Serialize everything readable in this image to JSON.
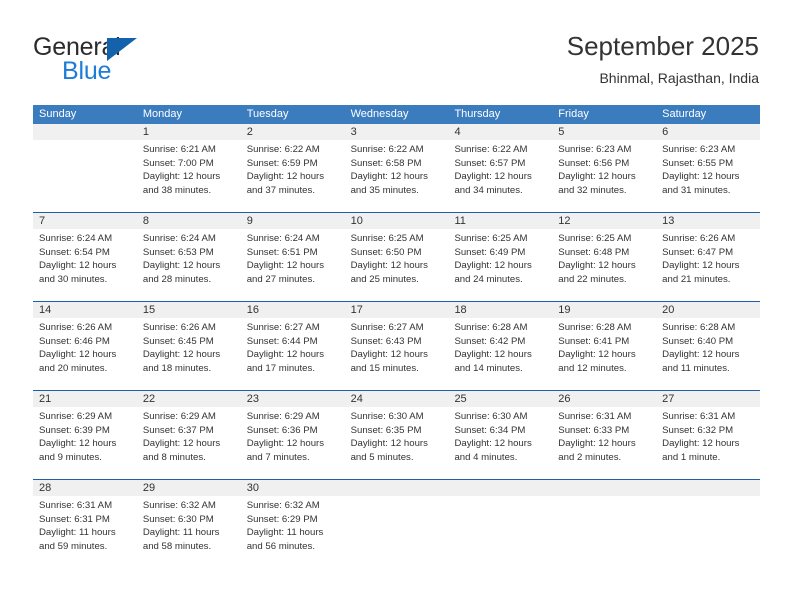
{
  "brand": {
    "name_part1": "General",
    "name_part2": "Blue",
    "triangle_color": "#1462ac",
    "blue_text_color": "#1c7cd6"
  },
  "header": {
    "title": "September 2025",
    "location": "Bhinmal, Rajasthan, India"
  },
  "theme": {
    "header_bar_color": "#3a7cbe",
    "week_separator_color": "#1f5fa8",
    "daynum_band_color": "#f0f0f0",
    "text_color": "#333333"
  },
  "weekdays": [
    "Sunday",
    "Monday",
    "Tuesday",
    "Wednesday",
    "Thursday",
    "Friday",
    "Saturday"
  ],
  "weeks": [
    {
      "days": [
        {
          "num": "",
          "lines": []
        },
        {
          "num": "1",
          "lines": [
            "Sunrise: 6:21 AM",
            "Sunset: 7:00 PM",
            "Daylight: 12 hours",
            "and 38 minutes."
          ]
        },
        {
          "num": "2",
          "lines": [
            "Sunrise: 6:22 AM",
            "Sunset: 6:59 PM",
            "Daylight: 12 hours",
            "and 37 minutes."
          ]
        },
        {
          "num": "3",
          "lines": [
            "Sunrise: 6:22 AM",
            "Sunset: 6:58 PM",
            "Daylight: 12 hours",
            "and 35 minutes."
          ]
        },
        {
          "num": "4",
          "lines": [
            "Sunrise: 6:22 AM",
            "Sunset: 6:57 PM",
            "Daylight: 12 hours",
            "and 34 minutes."
          ]
        },
        {
          "num": "5",
          "lines": [
            "Sunrise: 6:23 AM",
            "Sunset: 6:56 PM",
            "Daylight: 12 hours",
            "and 32 minutes."
          ]
        },
        {
          "num": "6",
          "lines": [
            "Sunrise: 6:23 AM",
            "Sunset: 6:55 PM",
            "Daylight: 12 hours",
            "and 31 minutes."
          ]
        }
      ]
    },
    {
      "days": [
        {
          "num": "7",
          "lines": [
            "Sunrise: 6:24 AM",
            "Sunset: 6:54 PM",
            "Daylight: 12 hours",
            "and 30 minutes."
          ]
        },
        {
          "num": "8",
          "lines": [
            "Sunrise: 6:24 AM",
            "Sunset: 6:53 PM",
            "Daylight: 12 hours",
            "and 28 minutes."
          ]
        },
        {
          "num": "9",
          "lines": [
            "Sunrise: 6:24 AM",
            "Sunset: 6:51 PM",
            "Daylight: 12 hours",
            "and 27 minutes."
          ]
        },
        {
          "num": "10",
          "lines": [
            "Sunrise: 6:25 AM",
            "Sunset: 6:50 PM",
            "Daylight: 12 hours",
            "and 25 minutes."
          ]
        },
        {
          "num": "11",
          "lines": [
            "Sunrise: 6:25 AM",
            "Sunset: 6:49 PM",
            "Daylight: 12 hours",
            "and 24 minutes."
          ]
        },
        {
          "num": "12",
          "lines": [
            "Sunrise: 6:25 AM",
            "Sunset: 6:48 PM",
            "Daylight: 12 hours",
            "and 22 minutes."
          ]
        },
        {
          "num": "13",
          "lines": [
            "Sunrise: 6:26 AM",
            "Sunset: 6:47 PM",
            "Daylight: 12 hours",
            "and 21 minutes."
          ]
        }
      ]
    },
    {
      "days": [
        {
          "num": "14",
          "lines": [
            "Sunrise: 6:26 AM",
            "Sunset: 6:46 PM",
            "Daylight: 12 hours",
            "and 20 minutes."
          ]
        },
        {
          "num": "15",
          "lines": [
            "Sunrise: 6:26 AM",
            "Sunset: 6:45 PM",
            "Daylight: 12 hours",
            "and 18 minutes."
          ]
        },
        {
          "num": "16",
          "lines": [
            "Sunrise: 6:27 AM",
            "Sunset: 6:44 PM",
            "Daylight: 12 hours",
            "and 17 minutes."
          ]
        },
        {
          "num": "17",
          "lines": [
            "Sunrise: 6:27 AM",
            "Sunset: 6:43 PM",
            "Daylight: 12 hours",
            "and 15 minutes."
          ]
        },
        {
          "num": "18",
          "lines": [
            "Sunrise: 6:28 AM",
            "Sunset: 6:42 PM",
            "Daylight: 12 hours",
            "and 14 minutes."
          ]
        },
        {
          "num": "19",
          "lines": [
            "Sunrise: 6:28 AM",
            "Sunset: 6:41 PM",
            "Daylight: 12 hours",
            "and 12 minutes."
          ]
        },
        {
          "num": "20",
          "lines": [
            "Sunrise: 6:28 AM",
            "Sunset: 6:40 PM",
            "Daylight: 12 hours",
            "and 11 minutes."
          ]
        }
      ]
    },
    {
      "days": [
        {
          "num": "21",
          "lines": [
            "Sunrise: 6:29 AM",
            "Sunset: 6:39 PM",
            "Daylight: 12 hours",
            "and 9 minutes."
          ]
        },
        {
          "num": "22",
          "lines": [
            "Sunrise: 6:29 AM",
            "Sunset: 6:37 PM",
            "Daylight: 12 hours",
            "and 8 minutes."
          ]
        },
        {
          "num": "23",
          "lines": [
            "Sunrise: 6:29 AM",
            "Sunset: 6:36 PM",
            "Daylight: 12 hours",
            "and 7 minutes."
          ]
        },
        {
          "num": "24",
          "lines": [
            "Sunrise: 6:30 AM",
            "Sunset: 6:35 PM",
            "Daylight: 12 hours",
            "and 5 minutes."
          ]
        },
        {
          "num": "25",
          "lines": [
            "Sunrise: 6:30 AM",
            "Sunset: 6:34 PM",
            "Daylight: 12 hours",
            "and 4 minutes."
          ]
        },
        {
          "num": "26",
          "lines": [
            "Sunrise: 6:31 AM",
            "Sunset: 6:33 PM",
            "Daylight: 12 hours",
            "and 2 minutes."
          ]
        },
        {
          "num": "27",
          "lines": [
            "Sunrise: 6:31 AM",
            "Sunset: 6:32 PM",
            "Daylight: 12 hours",
            "and 1 minute."
          ]
        }
      ]
    },
    {
      "days": [
        {
          "num": "28",
          "lines": [
            "Sunrise: 6:31 AM",
            "Sunset: 6:31 PM",
            "Daylight: 11 hours",
            "and 59 minutes."
          ]
        },
        {
          "num": "29",
          "lines": [
            "Sunrise: 6:32 AM",
            "Sunset: 6:30 PM",
            "Daylight: 11 hours",
            "and 58 minutes."
          ]
        },
        {
          "num": "30",
          "lines": [
            "Sunrise: 6:32 AM",
            "Sunset: 6:29 PM",
            "Daylight: 11 hours",
            "and 56 minutes."
          ]
        },
        {
          "num": "",
          "lines": []
        },
        {
          "num": "",
          "lines": []
        },
        {
          "num": "",
          "lines": []
        },
        {
          "num": "",
          "lines": []
        }
      ]
    }
  ]
}
